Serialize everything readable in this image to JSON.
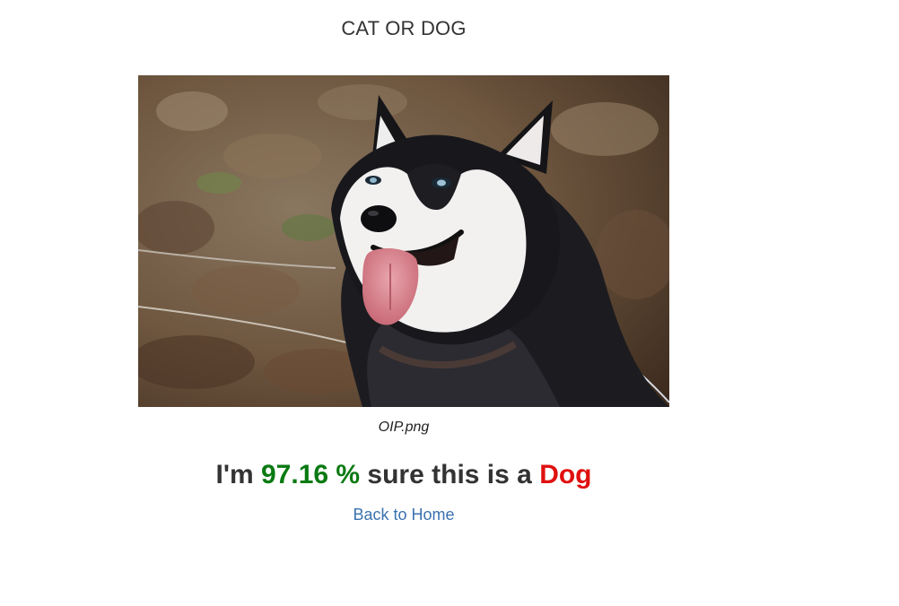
{
  "page": {
    "title": "CAT OR DOG"
  },
  "image": {
    "subject": "dog-photo",
    "filename": "OIP.png"
  },
  "result": {
    "prefix": "I'm",
    "confidence": "97.16 %",
    "middle": "sure this is a",
    "label": "Dog",
    "confidence_color": "#0a7a12",
    "label_color": "#e01010"
  },
  "nav": {
    "back_label": "Back to Home",
    "link_color": "#3a72b0"
  }
}
